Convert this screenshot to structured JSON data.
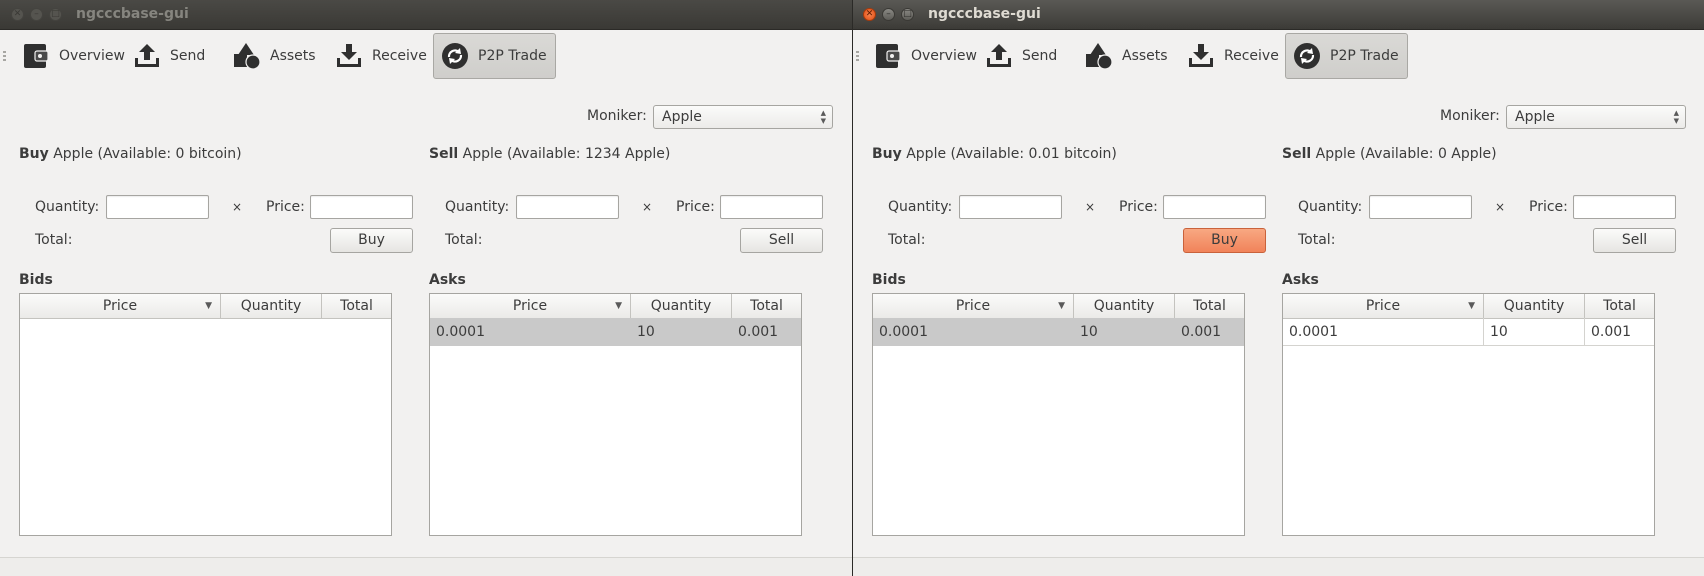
{
  "windows": [
    {
      "title": "ngcccbase-gui",
      "toolbar": {
        "overview": "Overview",
        "send": "Send",
        "assets": "Assets",
        "receive": "Receive",
        "p2p": "P2P Trade"
      },
      "moniker_label": "Moniker:",
      "moniker_value": "Apple",
      "buy": {
        "bold": "Buy",
        "rest": " Apple (Available: 0 bitcoin)",
        "quantity_label": "Quantity:",
        "times": "×",
        "price_label": "Price:",
        "total_label": "Total:",
        "button": "Buy"
      },
      "sell": {
        "bold": "Sell",
        "rest": " Apple (Available: 1234 Apple)",
        "quantity_label": "Quantity:",
        "times": "×",
        "price_label": "Price:",
        "total_label": "Total:",
        "button": "Sell"
      },
      "bids": {
        "title": "Bids",
        "columns": [
          "Price",
          "Quantity",
          "Total"
        ],
        "rows": []
      },
      "asks": {
        "title": "Asks",
        "columns": [
          "Price",
          "Quantity",
          "Total"
        ],
        "rows": [
          {
            "price": "0.0001",
            "quantity": "10",
            "total": "0.001"
          }
        ]
      }
    },
    {
      "title": "ngcccbase-gui",
      "toolbar": {
        "overview": "Overview",
        "send": "Send",
        "assets": "Assets",
        "receive": "Receive",
        "p2p": "P2P Trade"
      },
      "moniker_label": "Moniker:",
      "moniker_value": "Apple",
      "buy": {
        "bold": "Buy",
        "rest": " Apple (Available: 0.01 bitcoin)",
        "quantity_label": "Quantity:",
        "times": "×",
        "price_label": "Price:",
        "total_label": "Total:",
        "button": "Buy"
      },
      "sell": {
        "bold": "Sell",
        "rest": " Apple (Available: 0 Apple)",
        "quantity_label": "Quantity:",
        "times": "×",
        "price_label": "Price:",
        "total_label": "Total:",
        "button": "Sell"
      },
      "bids": {
        "title": "Bids",
        "columns": [
          "Price",
          "Quantity",
          "Total"
        ],
        "rows": [
          {
            "price": "0.0001",
            "quantity": "10",
            "total": "0.001"
          }
        ]
      },
      "asks": {
        "title": "Asks",
        "columns": [
          "Price",
          "Quantity",
          "Total"
        ],
        "rows": [
          {
            "price": "0.0001",
            "quantity": "10",
            "total": "0.001"
          }
        ]
      }
    }
  ],
  "colors": {
    "buy_button_highlight": "#f1835a",
    "selected_row": "#c9c9c9",
    "titlebar": "#3c3b37"
  },
  "icons": [
    "wallet-icon",
    "upload-icon",
    "shapes-icon",
    "download-icon",
    "sync-icon"
  ]
}
